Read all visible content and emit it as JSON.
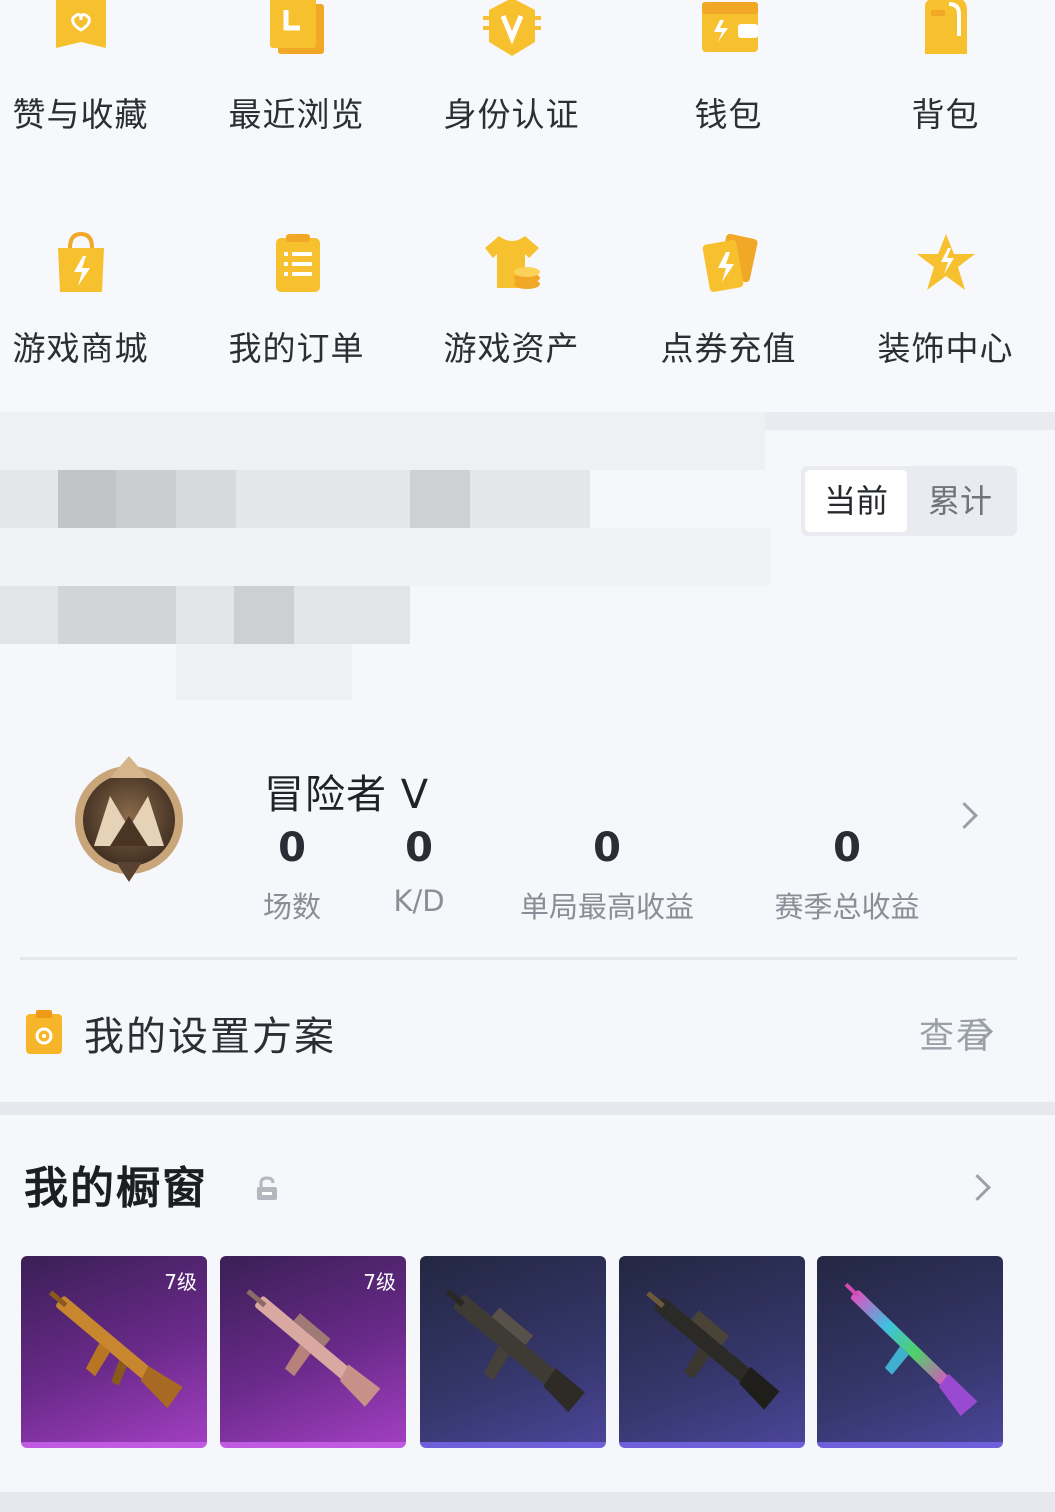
{
  "menu": {
    "items": [
      {
        "label": "赞与收藏",
        "icon": "heart-folder-icon"
      },
      {
        "label": "最近浏览",
        "icon": "history-icon"
      },
      {
        "label": "身份认证",
        "icon": "verified-v-icon"
      },
      {
        "label": "钱包",
        "icon": "wallet-icon"
      },
      {
        "label": "背包",
        "icon": "backpack-icon"
      },
      {
        "label": "游戏商城",
        "icon": "shopping-bag-icon"
      },
      {
        "label": "我的订单",
        "icon": "clipboard-icon"
      },
      {
        "label": "游戏资产",
        "icon": "tshirt-coin-icon"
      },
      {
        "label": "点券充值",
        "icon": "voucher-icon"
      },
      {
        "label": "装饰中心",
        "icon": "star-decor-icon"
      }
    ]
  },
  "stats_toggle": {
    "current": "当前",
    "total": "累计",
    "selected": "当前"
  },
  "rank": {
    "name": "冒险者 V",
    "badge_icon": "rank-badge-icon",
    "stats": [
      {
        "value": "0",
        "label": "场数"
      },
      {
        "value": "0",
        "label": "K/D"
      },
      {
        "value": "0",
        "label": "单局最高收益"
      },
      {
        "value": "0",
        "label": "赛季总收益"
      }
    ]
  },
  "settings": {
    "label": "我的设置方案",
    "link": "查看"
  },
  "showcase": {
    "title": "我的橱窗",
    "items": [
      {
        "level": "7级",
        "style": "purple",
        "weapon": "rifle-gold"
      },
      {
        "level": "7级",
        "style": "purple",
        "weapon": "rifle-pink"
      },
      {
        "level": "",
        "style": "blue",
        "weapon": "rifle-dark"
      },
      {
        "level": "",
        "style": "blue",
        "weapon": "rifle-black"
      },
      {
        "level": "",
        "style": "blue",
        "weapon": "rifle-rainbow"
      }
    ]
  },
  "colors": {
    "accent_yellow": "#f6b82a",
    "tile_purple": "#8a34b0",
    "tile_blue": "#35366a",
    "muted_text": "#8a8e96"
  }
}
